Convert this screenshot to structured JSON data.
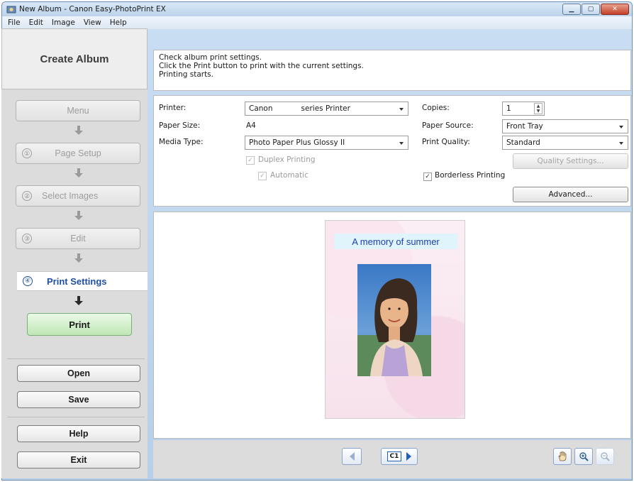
{
  "window": {
    "title": "New Album - Canon Easy-PhotoPrint EX",
    "controls": [
      "minimize-icon",
      "maximize-icon",
      "close-icon"
    ]
  },
  "menubar": {
    "items": [
      "File",
      "Edit",
      "Image",
      "View",
      "Help"
    ]
  },
  "sidebar": {
    "title": "Create Album",
    "steps": [
      {
        "num": "",
        "label": "Menu"
      },
      {
        "num": "①",
        "label": "Page Setup"
      },
      {
        "num": "②",
        "label": "Select Images"
      },
      {
        "num": "③",
        "label": "Edit"
      }
    ],
    "active_step": {
      "num": "④",
      "label": "Print Settings"
    },
    "print_label": "Print",
    "open_label": "Open",
    "save_label": "Save",
    "help_label": "Help",
    "exit_label": "Exit"
  },
  "info": {
    "lines": [
      "Check album print settings.",
      "Click the Print button to print with the current settings.",
      "Printing starts."
    ]
  },
  "settings": {
    "printer_label": "Printer:",
    "printer_value": "Canon            series Printer",
    "paper_size_label": "Paper Size:",
    "paper_size_value": "A4",
    "media_type_label": "Media Type:",
    "media_type_value": "Photo Paper Plus Glossy II",
    "duplex_label": "Duplex Printing",
    "duplex_checked": true,
    "automatic_label": "Automatic",
    "automatic_checked": true,
    "copies_label": "Copies:",
    "copies_value": "1",
    "paper_source_label": "Paper Source:",
    "paper_source_value": "Front Tray",
    "print_quality_label": "Print Quality:",
    "print_quality_value": "Standard",
    "quality_settings_label": "Quality Settings...",
    "borderless_label": "Borderless Printing",
    "borderless_checked": true,
    "advanced_label": "Advanced..."
  },
  "preview": {
    "album_title": "A memory of summer",
    "page_badge": "C1"
  },
  "colors": {
    "accent_blue": "#1f4fa0",
    "print_button": "#bfe7b6",
    "album_title_text": "#1d3fb0"
  }
}
